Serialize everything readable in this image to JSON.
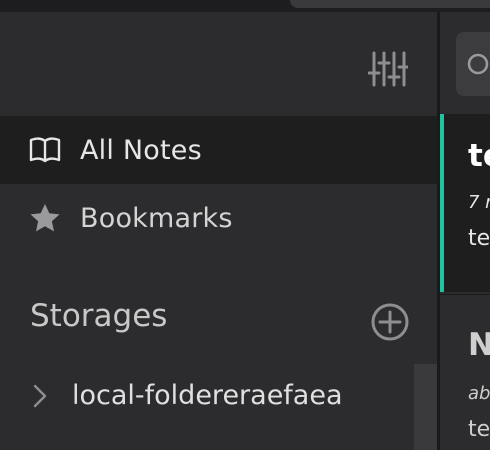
{
  "sidebar": {
    "header": {
      "preferences_icon": "sliders-icon"
    },
    "nav": [
      {
        "label": "All Notes",
        "icon": "book-open-icon",
        "active": true
      },
      {
        "label": "Bookmarks",
        "icon": "star-icon",
        "active": false
      }
    ],
    "storages": {
      "title": "Storages",
      "add_icon": "plus-circle-icon",
      "items": [
        {
          "label": "local-foldereraefaea",
          "icon": "chevron-right-icon"
        }
      ]
    }
  },
  "note_list": {
    "search_icon": "search-icon",
    "notes": [
      {
        "title": "te",
        "meta": "7 r",
        "body": "te",
        "active": true
      },
      {
        "title": "N",
        "meta": "ab",
        "body": "te",
        "active": false
      }
    ]
  },
  "colors": {
    "background": "#2c2c2e",
    "active_item": "#1e1e1f",
    "accent": "#1fc3a0",
    "text": "#e6e6e6"
  }
}
